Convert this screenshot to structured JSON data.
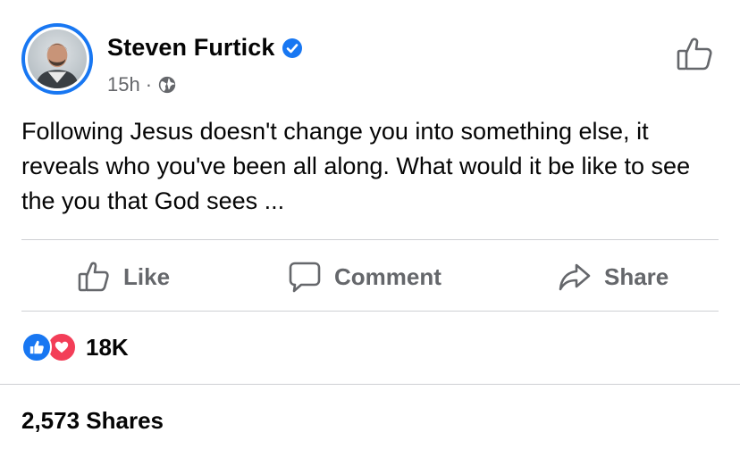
{
  "post": {
    "author": "Steven Furtick",
    "time": "15h",
    "separator": "·",
    "text": "Following Jesus doesn't change you into something else, it reveals who you've been all along. What would it be like to see the you that God sees ..."
  },
  "actions": {
    "like": "Like",
    "comment": "Comment",
    "share": "Share"
  },
  "stats": {
    "reaction_count": "18K",
    "shares": "2,573 Shares"
  },
  "colors": {
    "brand_blue": "#1877f2",
    "love_red": "#f33e58",
    "secondary_text": "#65676b"
  },
  "icons": {
    "verified": "verified-badge-icon",
    "audience": "globe-icon",
    "like": "thumbs-up-icon",
    "comment": "speech-bubble-icon",
    "share": "share-arrow-icon"
  }
}
